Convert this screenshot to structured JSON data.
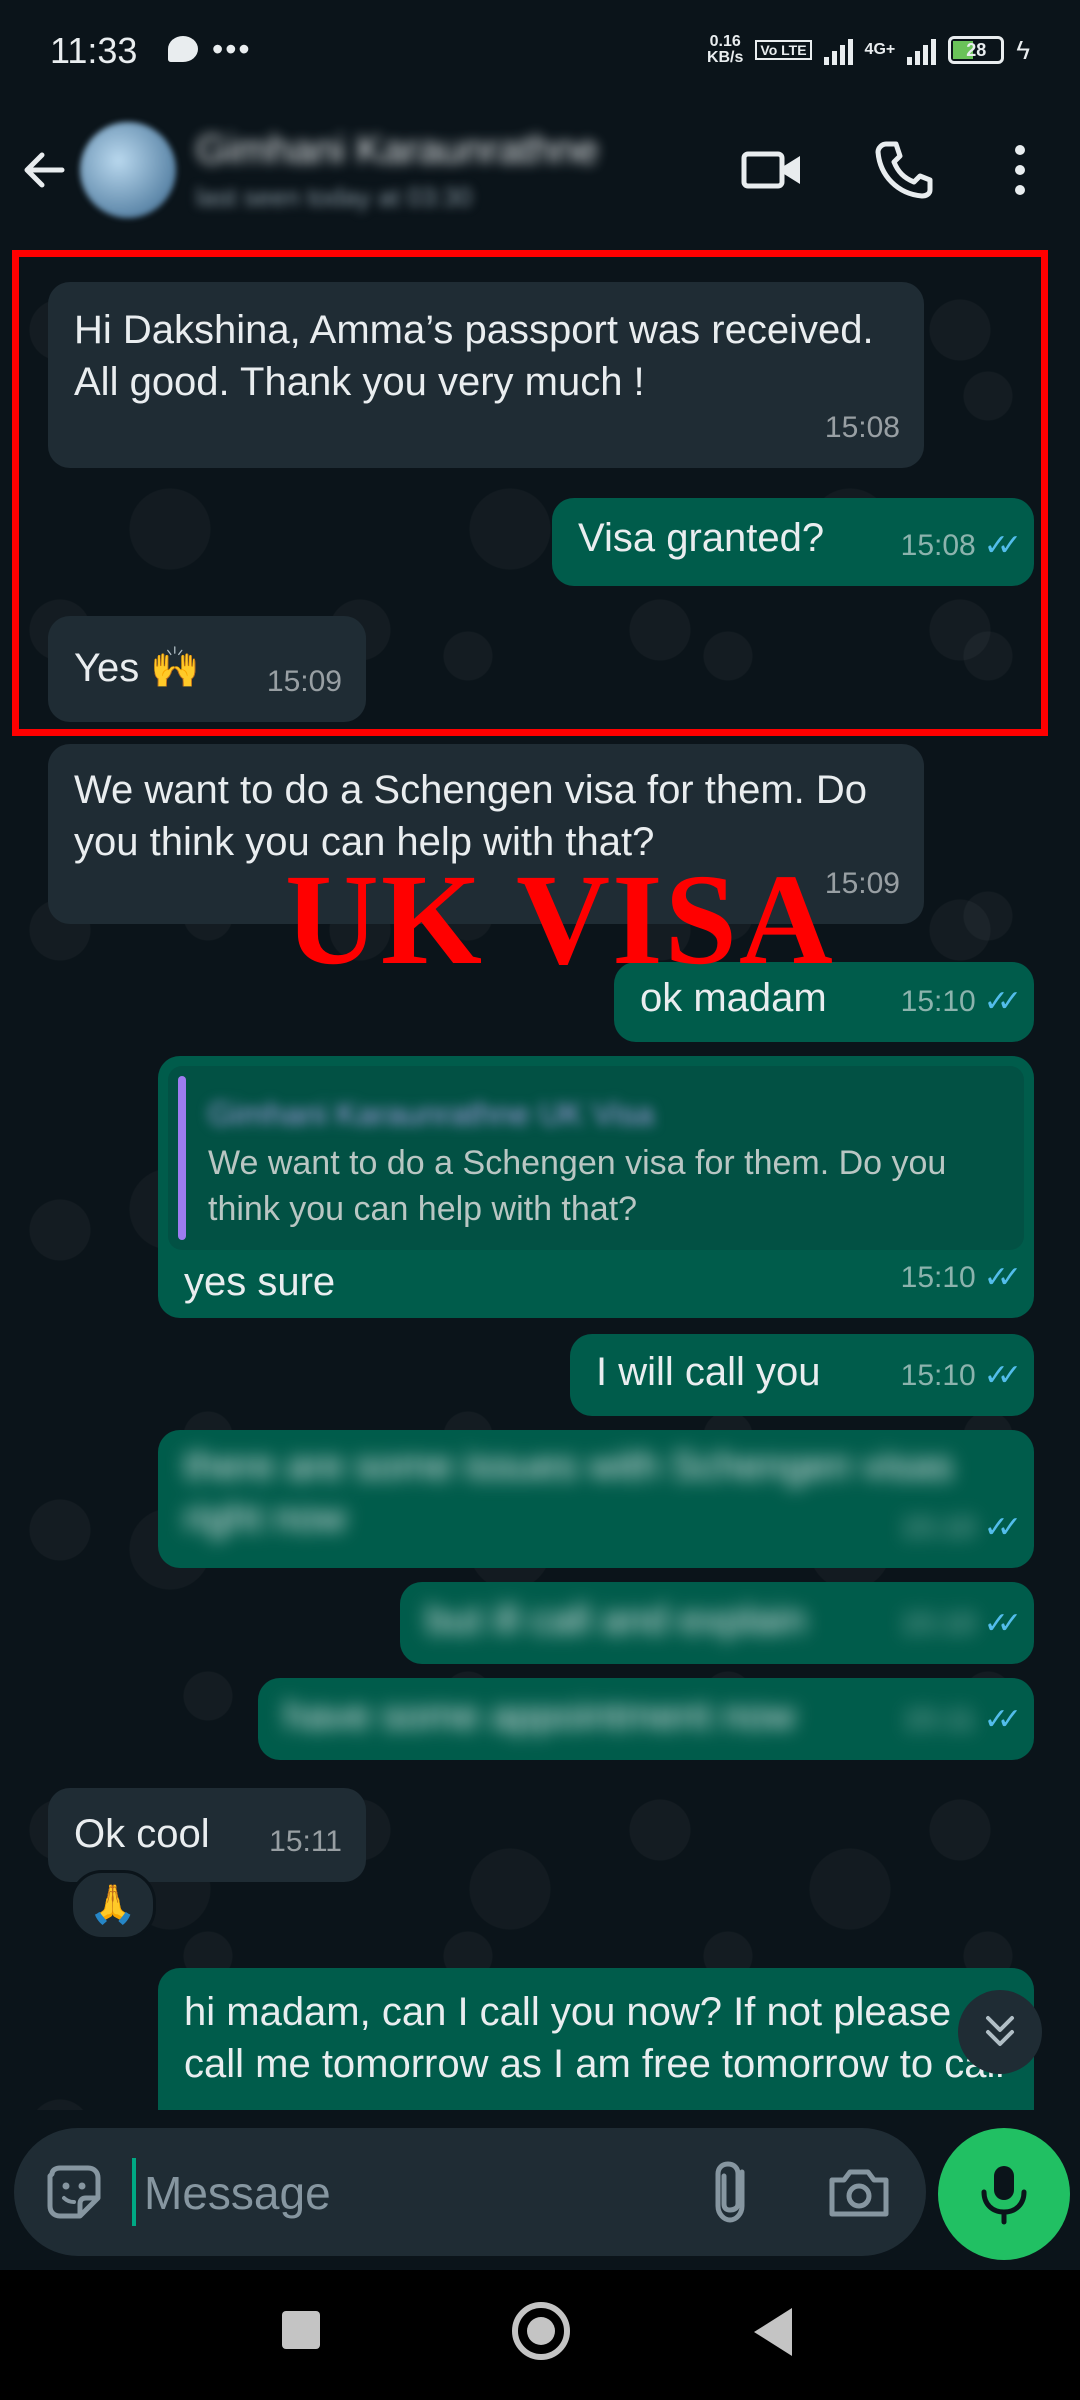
{
  "status_bar": {
    "time": "11:33",
    "dots": "•••",
    "speed_value": "0.16",
    "speed_unit": "KB/s",
    "volte": "Vo LTE",
    "network": "4G+",
    "battery": "28"
  },
  "header": {
    "contact_name": "Gimhani Karaunrathne",
    "last_seen": "last seen today at 03:30"
  },
  "annotation": {
    "overlay_text": "UK VISA",
    "highlight_color": "#ff0000"
  },
  "messages": [
    {
      "dir": "in",
      "text": "Hi Dakshina, Amma’s passport was received. All good. Thank you very much !",
      "time": "15:08"
    },
    {
      "dir": "out",
      "text": "Visa granted?",
      "time": "15:08"
    },
    {
      "dir": "in",
      "text": "Yes 🙌",
      "time": "15:09"
    },
    {
      "dir": "in",
      "text": "We want to do a Schengen visa for them. Do you think   you can help with that?",
      "time": "15:09"
    },
    {
      "dir": "out",
      "text": "ok madam",
      "time": "15:10"
    },
    {
      "dir": "out",
      "text": "yes sure",
      "time": "15:10",
      "quote": {
        "name": "Gimhani Karaunrathne UK Visa",
        "text": "We want to do a Schengen visa for them. Do you think   you can help with that?"
      }
    },
    {
      "dir": "out",
      "text": "I will call you",
      "time": "15:10"
    },
    {
      "dir": "out",
      "text": "there are some issues with Schengen visas right now",
      "time": "15:10"
    },
    {
      "dir": "out",
      "text": "but ill call and explain",
      "time": "15:10"
    },
    {
      "dir": "out",
      "text": "have some appointment now",
      "time": "15:11"
    },
    {
      "dir": "in",
      "text": "Ok cool",
      "time": "15:11",
      "reaction": "🙏"
    },
    {
      "dir": "out",
      "text": "hi madam, can I call you now? If not please call me tomorrow as I am free tomorrow to call",
      "time": ""
    }
  ],
  "input": {
    "placeholder": "Message"
  },
  "colors": {
    "background": "#0b141a",
    "incoming_bubble": "#1f2c34",
    "outgoing_bubble": "#005c4b",
    "accent": "#21c063",
    "read_ticks": "#53bdeb"
  },
  "icons": {
    "back": "back-arrow-icon",
    "video": "video-call-icon",
    "phone": "voice-call-icon",
    "menu": "more-options-icon",
    "emoji": "sticker-icon",
    "attach": "paperclip-icon",
    "camera": "camera-icon",
    "mic": "microphone-icon",
    "scroll": "double-chevron-down-icon"
  }
}
